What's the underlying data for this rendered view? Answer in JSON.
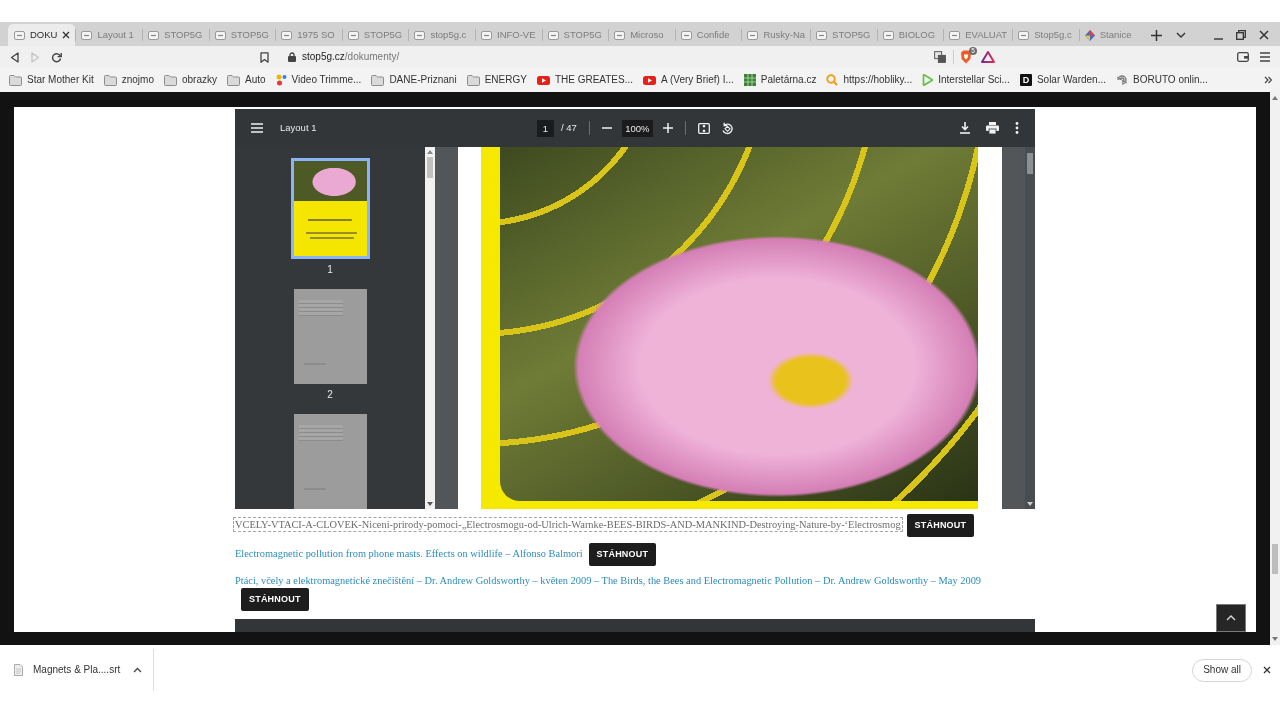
{
  "browser": {
    "tabs": [
      {
        "title": "DOKU",
        "selected": true,
        "kind": "page"
      },
      {
        "title": "Layout 1",
        "selected": false,
        "kind": "page"
      },
      {
        "title": "STOP5G",
        "selected": false,
        "kind": "page"
      },
      {
        "title": "STOP5G",
        "selected": false,
        "kind": "page"
      },
      {
        "title": "1975 SO",
        "selected": false,
        "kind": "page"
      },
      {
        "title": "STOP5G",
        "selected": false,
        "kind": "page"
      },
      {
        "title": "stop5g.c",
        "selected": false,
        "kind": "page"
      },
      {
        "title": "INFO-VE",
        "selected": false,
        "kind": "page"
      },
      {
        "title": "STOP5G",
        "selected": false,
        "kind": "page"
      },
      {
        "title": "Microso",
        "selected": false,
        "kind": "page"
      },
      {
        "title": "Confide",
        "selected": false,
        "kind": "page"
      },
      {
        "title": "Rusky-Na",
        "selected": false,
        "kind": "page"
      },
      {
        "title": "STOP5G",
        "selected": false,
        "kind": "page"
      },
      {
        "title": "BIOLOG",
        "selected": false,
        "kind": "page"
      },
      {
        "title": "EVALUAT",
        "selected": false,
        "kind": "page"
      },
      {
        "title": "Stop5g.c",
        "selected": false,
        "kind": "page"
      },
      {
        "title": "Stanice",
        "selected": false,
        "kind": "site"
      }
    ],
    "nav": [
      {
        "kind": "back",
        "disabled": false
      },
      {
        "kind": "forward",
        "disabled": true
      },
      {
        "kind": "reload",
        "disabled": false
      }
    ],
    "address": {
      "host": "stop5g.cz",
      "path": "/dokumenty/"
    },
    "shields_badge": "5",
    "bookmarks": [
      {
        "label": "Star Mother Kit",
        "kind": "folder"
      },
      {
        "label": "znojmo",
        "kind": "folder"
      },
      {
        "label": "obrazky",
        "kind": "folder"
      },
      {
        "label": "Auto",
        "kind": "folder"
      },
      {
        "label": "Video Trimme...",
        "kind": "dots"
      },
      {
        "label": "DANE-Priznani",
        "kind": "folder"
      },
      {
        "label": "ENERGY",
        "kind": "folder"
      },
      {
        "label": "THE GREATES...",
        "kind": "video"
      },
      {
        "label": "A (Very Brief) I...",
        "kind": "video"
      },
      {
        "label": "Paletárna.cz",
        "kind": "grid"
      },
      {
        "label": "https://hobliky...",
        "kind": "magnifier"
      },
      {
        "label": "Interstellar Sci...",
        "kind": "play"
      },
      {
        "label": "Solar Warden...",
        "kind": "letter",
        "icon_text": "D"
      },
      {
        "label": "BORUTO onlin...",
        "kind": "swirl"
      }
    ]
  },
  "pdf_viewer": {
    "title": "Layout 1",
    "page": "1",
    "page_count": "/ 47",
    "zoom": "100%",
    "thumbnails": [
      {
        "label": "1",
        "selected": true,
        "kind": "cover"
      },
      {
        "label": "2",
        "selected": false,
        "kind": "text"
      },
      {
        "selected": false,
        "kind": "text"
      }
    ]
  },
  "documents": [
    {
      "title": "VCELY-VTACI-A-CLOVEK-Niceni-prirody-pomoci-„Electrosmogu-od-Ulrich-Warnke-BEES-BIRDS-AND-MANKIND-Destroying-Nature-by-‘Electrosmog",
      "focused": true,
      "button": "STÁHNOUT"
    },
    {
      "title": "Electromagnetic pollution from phone masts. Effects on wildlife – Alfonso Balmori",
      "focused": false,
      "button": "STÁHNOUT"
    },
    {
      "title": "Ptáci, včely a elektromagnetické znečištění – Dr. Andrew Goldsworthy – květen 2009 – The Birds, the Bees and Electromagnetic Pollution – Dr. Andrew Goldsworthy – May 2009",
      "focused": false,
      "button": "STÁHNOUT"
    }
  ],
  "download_bar": {
    "file": "Magnets & Pla....srt",
    "button": "Show all"
  }
}
